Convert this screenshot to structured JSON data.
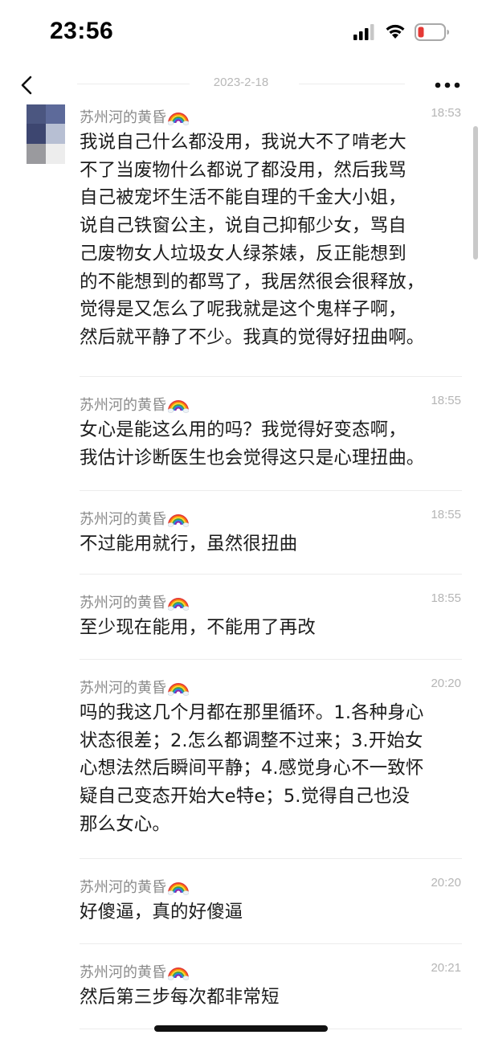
{
  "status_bar": {
    "time": "23:56"
  },
  "nav": {
    "date": "2023-2-18",
    "back_icon": "chevron-left-icon",
    "more_icon": "more-dots-icon"
  },
  "colors": {
    "rainbow": [
      "#e53935",
      "#fb8c00",
      "#fdd835",
      "#43a047",
      "#1e88e5",
      "#8e24aa"
    ],
    "battery_low": "#e53935"
  },
  "messages": [
    {
      "name": "苏州河的黄昏",
      "time": "18:53",
      "lines": [
        "我说自己什么都没用，我说大不了啃老大",
        "不了当废物什么都说了都没用，然后我骂",
        "自己被宠坏生活不能自理的千金大小姐，",
        "说自己铁窗公主，说自己抑郁少女，骂自",
        "己废物女人垃圾女人绿茶婊，反正能想到",
        "的不能想到的都骂了，我居然很会很释放，",
        "觉得是又怎么了呢我就是这个鬼样子啊，",
        "然后就平静了不少。我真的觉得好扭曲啊。"
      ]
    },
    {
      "name": "苏州河的黄昏",
      "time": "18:55",
      "lines": [
        "女心是能这么用的吗？我觉得好变态啊，",
        "我估计诊断医生也会觉得这只是心理扭曲。"
      ]
    },
    {
      "name": "苏州河的黄昏",
      "time": "18:55",
      "lines": [
        "不过能用就行，虽然很扭曲"
      ]
    },
    {
      "name": "苏州河的黄昏",
      "time": "18:55",
      "lines": [
        "至少现在能用，不能用了再改"
      ]
    },
    {
      "name": "苏州河的黄昏",
      "time": "20:20",
      "lines": [
        "吗的我这几个月都在那里循环。1.各种身心",
        "状态很差；2.怎么都调整不过来；3.开始女",
        "心想法然后瞬间平静；4.感觉身心不一致怀",
        "疑自己变态开始大e特e；5.觉得自己也没",
        "那么女心。"
      ]
    },
    {
      "name": "苏州河的黄昏",
      "time": "20:20",
      "lines": [
        "好傻逼，真的好傻逼"
      ]
    },
    {
      "name": "苏州河的黄昏",
      "time": "20:21",
      "lines": [
        "然后第三步每次都非常短"
      ]
    }
  ]
}
